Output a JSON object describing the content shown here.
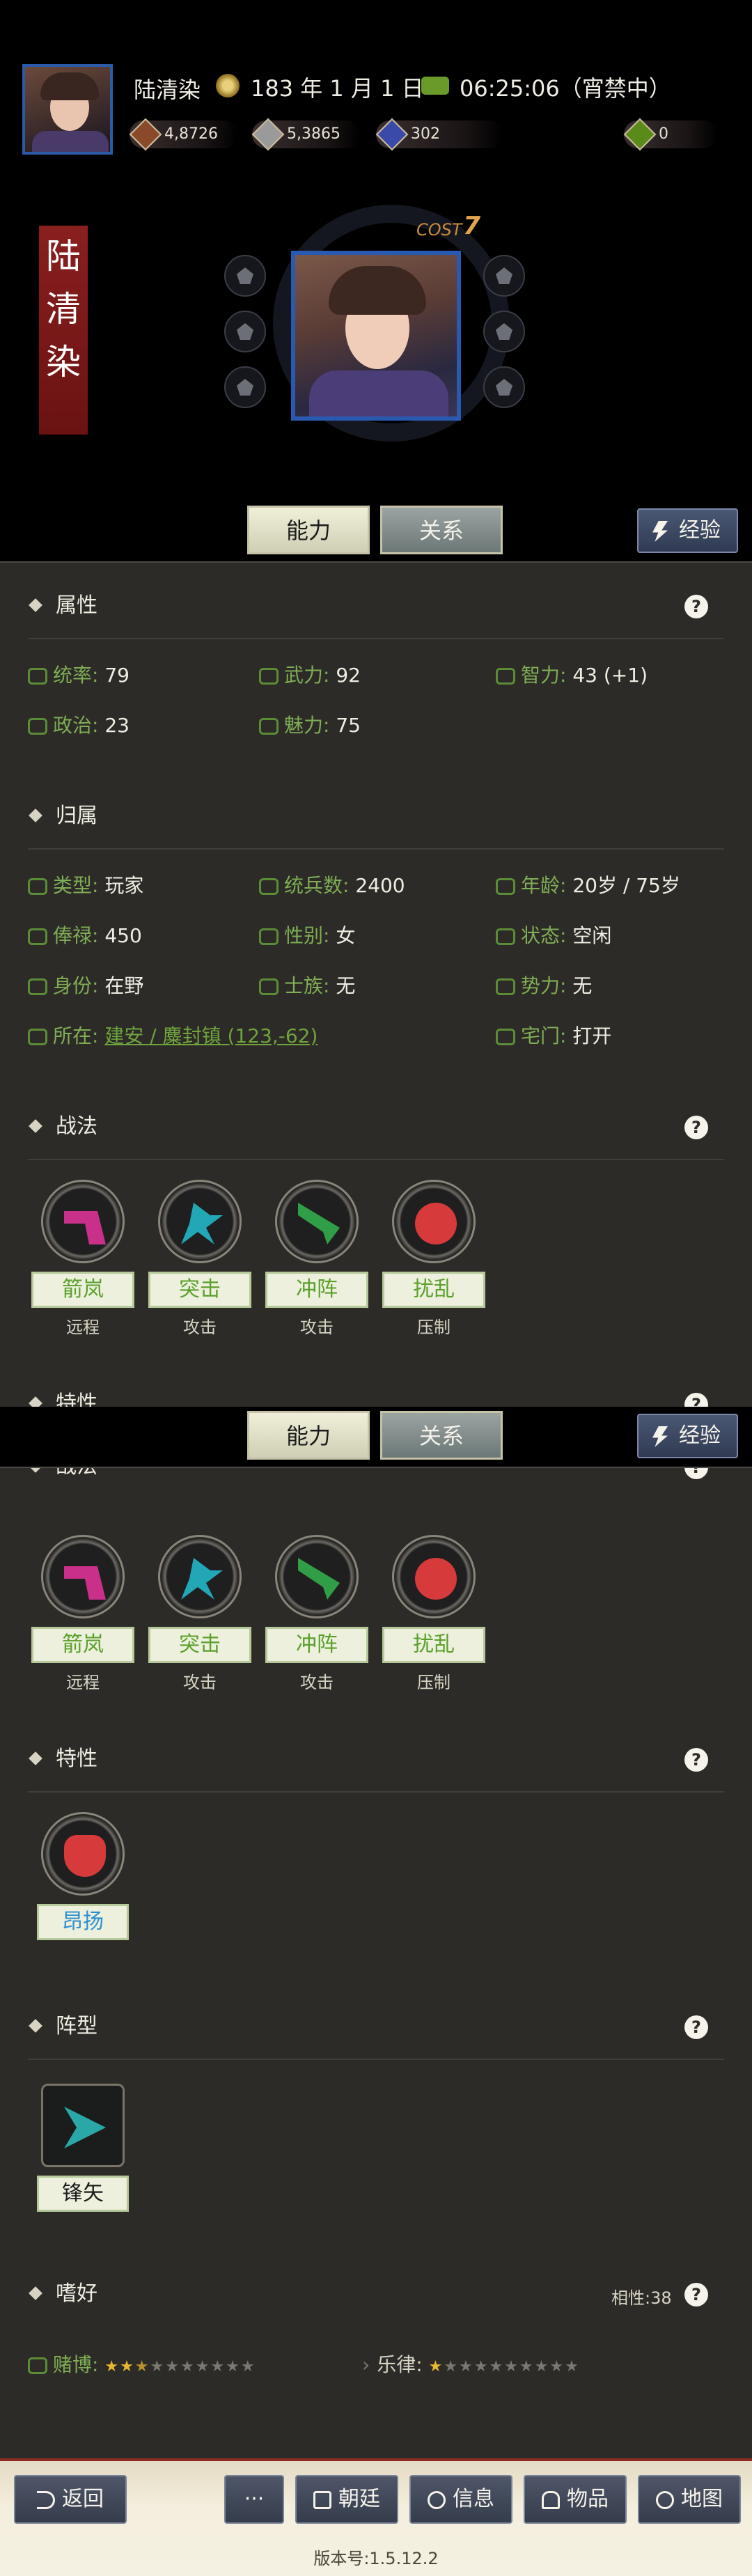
{
  "header": {
    "player_name": "陆清染",
    "date": "183 年 1 月 1 日",
    "time": "06:25:06（宵禁中）",
    "resources": [
      {
        "name": "copper-coin-icon",
        "value": "4,8726"
      },
      {
        "name": "silver-coin-icon",
        "value": "5,3865"
      },
      {
        "name": "jade-coin-icon",
        "value": "302"
      },
      {
        "name": "green-gem-icon",
        "value": "0"
      }
    ]
  },
  "hero": {
    "name_chars": [
      "陆",
      "清",
      "染"
    ],
    "cost_label": "COST",
    "cost_value": "7"
  },
  "tabs": {
    "ability": "能力",
    "relations": "关系",
    "experience": "经验"
  },
  "sections": {
    "attributes": {
      "title": "属性",
      "help": "?",
      "items": [
        {
          "label": "统率:",
          "value": "79"
        },
        {
          "label": "武力:",
          "value": "92"
        },
        {
          "label": "智力:",
          "value": "43 (+1)"
        },
        {
          "label": "政治:",
          "value": "23"
        },
        {
          "label": "魅力:",
          "value": "75"
        }
      ]
    },
    "affiliation": {
      "title": "归属",
      "items": [
        {
          "label": "类型:",
          "value": "玩家"
        },
        {
          "label": "统兵数:",
          "value": "2400"
        },
        {
          "label": "年龄:",
          "value": "20岁 / 75岁"
        },
        {
          "label": "俸禄:",
          "value": "450"
        },
        {
          "label": "性别:",
          "value": "女"
        },
        {
          "label": "状态:",
          "value": "空闲"
        },
        {
          "label": "身份:",
          "value": "在野"
        },
        {
          "label": "士族:",
          "value": "无"
        },
        {
          "label": "势力:",
          "value": "无"
        },
        {
          "label": "所在:",
          "value": "建安 / 麋封镇 (123,-62)"
        },
        {
          "label": "宅门:",
          "value": "打开"
        }
      ]
    },
    "tactics": {
      "title": "战法",
      "help": "?",
      "skills": [
        {
          "name": "箭岚",
          "type": "远程"
        },
        {
          "name": "突击",
          "type": "攻击"
        },
        {
          "name": "冲阵",
          "type": "攻击"
        },
        {
          "name": "扰乱",
          "type": "压制"
        }
      ]
    },
    "traits": {
      "title": "特性",
      "help": "?",
      "items": [
        {
          "name": "昂扬"
        }
      ]
    },
    "formation": {
      "title": "阵型",
      "help": "?",
      "items": [
        {
          "name": "锋矢"
        }
      ]
    },
    "hobbies": {
      "title": "嗜好",
      "help": "?",
      "affinity": "相性:38",
      "items": [
        {
          "label": "赌博:",
          "stars": 2.5,
          "max": 10
        },
        {
          "label": "乐律:",
          "stars": 1,
          "max": 10
        }
      ]
    }
  },
  "nav": {
    "back": "返回",
    "more": "···",
    "court": "朝廷",
    "info": "信息",
    "items": "物品",
    "map": "地图",
    "version": "版本号:1.5.12.2"
  },
  "colors": {
    "panel_bg": "#2c2b27",
    "accent_green": "#7fae55",
    "banner_red": "#8a1f1f",
    "frame_blue": "#2a5ab0"
  }
}
